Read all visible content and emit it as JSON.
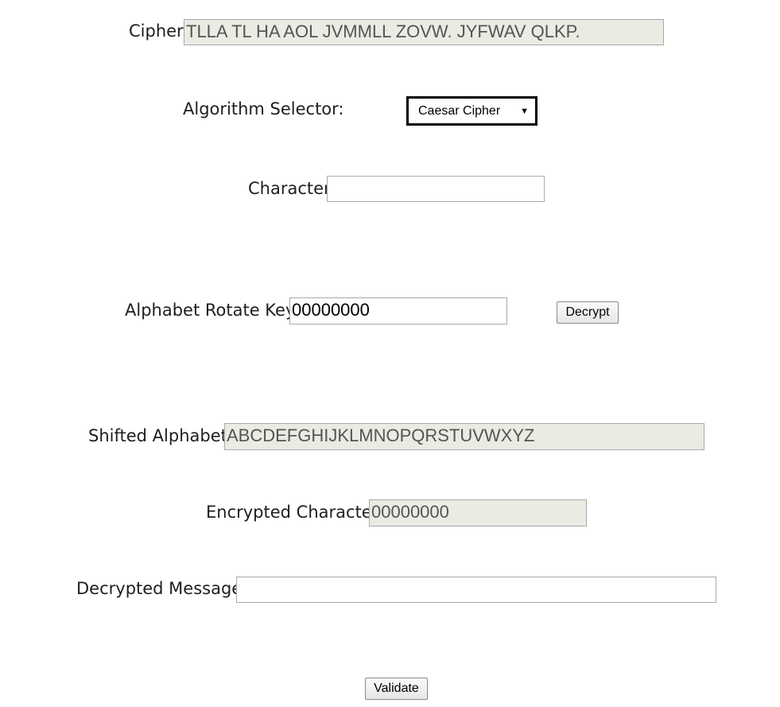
{
  "cipher": {
    "label": "Cipher:",
    "value": "TLLA TL HA AOL JVMMLL ZOVW. JYFWAV QLKP."
  },
  "algorithm": {
    "label": "Algorithm Selector:",
    "selected": "Caesar Cipher",
    "caret": "▼"
  },
  "character": {
    "label": "Character:",
    "value": ""
  },
  "rotate_key": {
    "label": "Alphabet Rotate Key:",
    "value": "00000000"
  },
  "decrypt_button": "Decrypt",
  "shifted_alphabet": {
    "label": "Shifted Alphabet:",
    "value": "ABCDEFGHIJKLMNOPQRSTUVWXYZ"
  },
  "encrypted_character": {
    "label": "Encrypted Character:",
    "value": "00000000"
  },
  "decrypted_message": {
    "label": "Decrypted Message:",
    "value": ""
  },
  "validate_button": "Validate"
}
